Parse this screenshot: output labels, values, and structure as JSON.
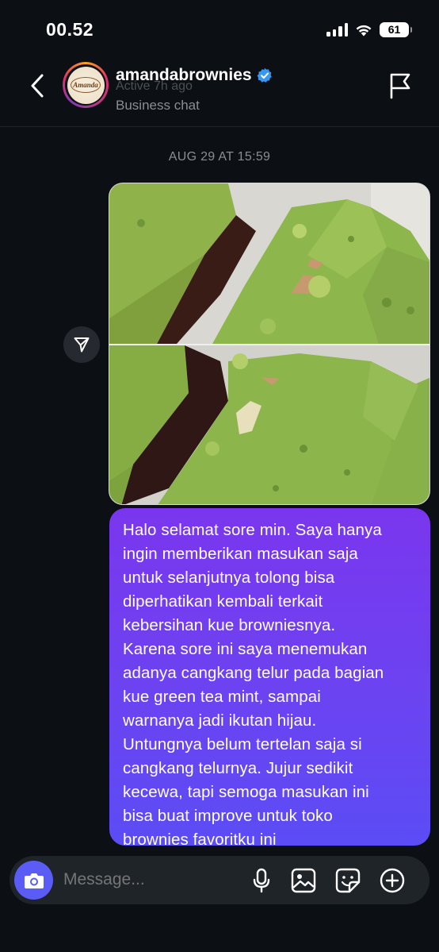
{
  "status_bar": {
    "time": "00.52",
    "battery": "61"
  },
  "header": {
    "username": "amandabrownies",
    "verified": true,
    "active_status": "Active 7h ago",
    "subtitle": "Business chat",
    "avatar_text": "Amanda",
    "icons": {
      "back": "chevron-left-icon",
      "report": "flag-icon"
    }
  },
  "chat": {
    "date_label": "AUG 29 AT 15:59",
    "message": "Halo selamat sore min. Saya hanya\ningin memberikan masukan saja\nuntuk selanjutnya tolong bisa\ndiperhatikan kembali terkait\nkebersihan kue browniesnya.\nKarena sore ini saya menemukan\nadanya cangkang telur pada bagian\nkue green tea mint, sampai\nwarnanya jadi ikutan hijau.\nUntungnya belum tertelan saja si\ncangkang telurnya. Jujur sedikit\nkecewa, tapi semoga masukan ini\nbisa buat improve untuk toko\nbrownies favoritku ini",
    "colors": {
      "bubble_top": "#7a36ee",
      "bubble_bottom": "#5b4cf5",
      "background": "#0c1014"
    }
  },
  "composer": {
    "placeholder": "Message...",
    "icons": [
      "camera-icon",
      "microphone-icon",
      "gallery-icon",
      "sticker-icon",
      "plus-circle-icon"
    ]
  }
}
